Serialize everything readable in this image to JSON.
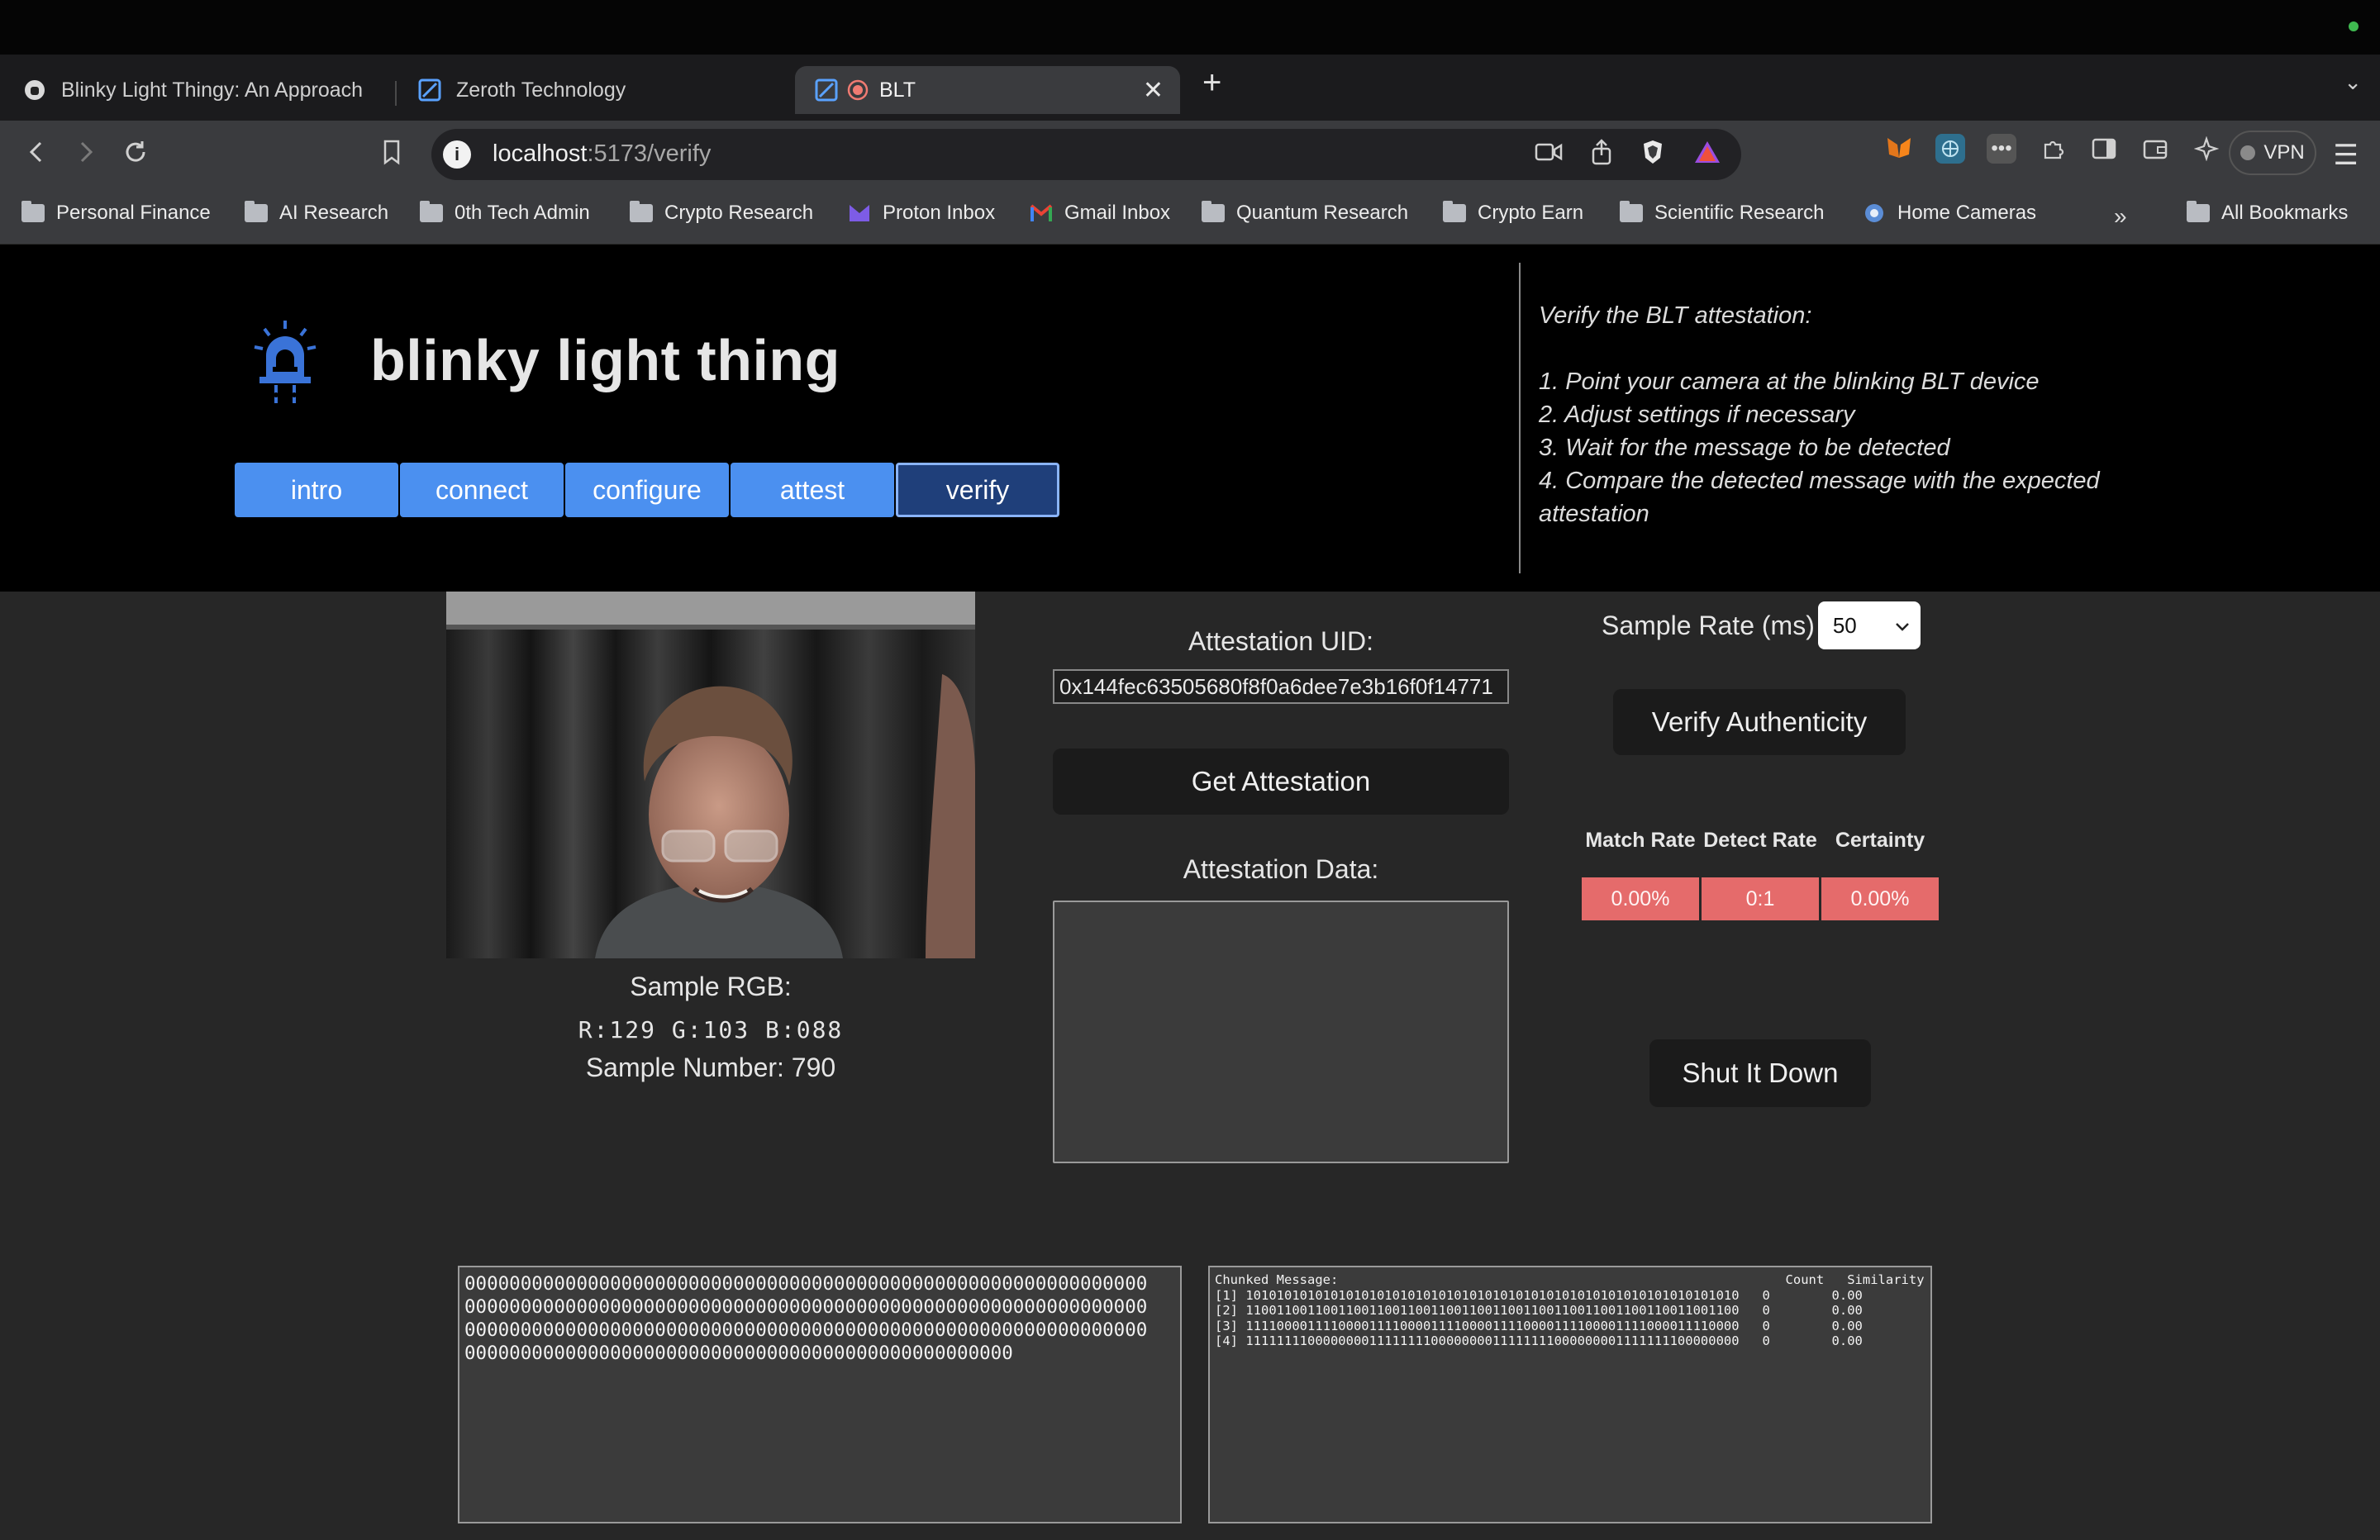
{
  "browser": {
    "tabs": [
      {
        "title": "Blinky Light Thingy: An Approach",
        "active": false
      },
      {
        "title": "Zeroth Technology",
        "active": false
      },
      {
        "title": "BLT",
        "active": true
      }
    ],
    "url_host": "localhost",
    "url_path": ":5173/verify",
    "vpn_label": "VPN",
    "bookmarks": [
      {
        "label": "Personal Finance",
        "icon": "folder-icon"
      },
      {
        "label": "AI Research",
        "icon": "folder-icon"
      },
      {
        "label": "0th Tech Admin",
        "icon": "folder-icon"
      },
      {
        "label": "Crypto Research",
        "icon": "folder-icon"
      },
      {
        "label": "Proton Inbox",
        "icon": "proton-icon"
      },
      {
        "label": "Gmail Inbox",
        "icon": "gmail-icon"
      },
      {
        "label": "Quantum Research",
        "icon": "folder-icon"
      },
      {
        "label": "Crypto Earn",
        "icon": "folder-icon"
      },
      {
        "label": "Scientific Research",
        "icon": "folder-icon"
      },
      {
        "label": "Home Cameras",
        "icon": "globe-icon"
      }
    ],
    "all_bookmarks": "All Bookmarks"
  },
  "app": {
    "title": "blinky light thing",
    "nav": [
      {
        "label": "intro"
      },
      {
        "label": "connect"
      },
      {
        "label": "configure"
      },
      {
        "label": "attest"
      },
      {
        "label": "verify"
      }
    ],
    "active_nav": "verify",
    "instructions": {
      "heading": "Verify the BLT attestation:",
      "steps": [
        "1. Point your camera at the blinking BLT device",
        "2. Adjust settings if necessary",
        "3. Wait for the message to be detected",
        "4. Compare the detected message with the expected attestation"
      ]
    }
  },
  "camera": {
    "sample_label": "Sample RGB:",
    "rgb": "R:129 G:103 B:088",
    "sample_number": "Sample Number: 790"
  },
  "attestation": {
    "uid_label": "Attestation UID:",
    "uid_value": "0x144fec63505680f8f0a6dee7e3b16f0f14771",
    "get_button": "Get Attestation",
    "data_label": "Attestation Data:",
    "data_value": ""
  },
  "verify": {
    "rate_label": "Sample Rate (ms)",
    "rate_value": "50",
    "verify_button": "Verify Authenticity",
    "metrics": [
      {
        "head": "Match Rate",
        "value": "0.00%"
      },
      {
        "head": "Detect Rate",
        "value": "0:1"
      },
      {
        "head": "Certainty",
        "value": "0.00%"
      }
    ],
    "shut_button": "Shut It Down",
    "status_color": "#e56b6b"
  },
  "bits_lines": [
    "0000000000000000000000000000000000000000000000000000000000000",
    "0000000000000000000000000000000000000000000000000000000000000",
    "0000000000000000000000000000000000000000000000000000000000000",
    "0000000000000000000000000000000000000000000000000"
  ],
  "chunked": {
    "header": "Chunked Message:                                                          Count   Similarity",
    "rows": [
      "[1] 1010101010101010101010101010101010101010101010101010101010101010   0        0.00",
      "[2] 1100110011001100110011001100110011001100110011001100110011001100   0        0.00",
      "[3] 1111000011110000111100001111000011110000111100001111000011110000   0        0.00",
      "[4] 1111111100000000111111110000000011111111000000001111111100000000   0        0.00"
    ]
  }
}
